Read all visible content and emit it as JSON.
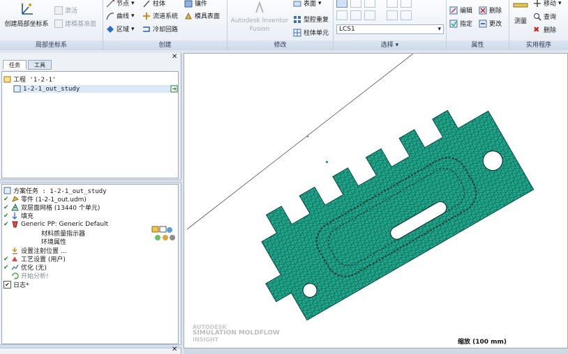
{
  "ribbon": {
    "local_cs": {
      "create_label": "创建局部坐标系",
      "activate_label": "激活",
      "modeling_base_label": "建模基准面",
      "group_label": "局部坐标系"
    },
    "create": {
      "node_label": "节点",
      "curve_label": "曲线",
      "region_label": "区域",
      "column_label": "柱体",
      "runner_label": "流道系统",
      "cooling_label": "冷却回路",
      "insert_label": "镶件",
      "mold_surface_label": "模具表面",
      "group_label": "创建"
    },
    "modify": {
      "fusion_label": "Autodesk Inventor Fusion",
      "surface_label": "表面",
      "cavity_label": "型腔重复",
      "column_unit_label": "柱体单元",
      "group_label": "修改"
    },
    "select": {
      "lcs_value": "LCS1",
      "group_label": "选择"
    },
    "properties": {
      "edit_label": "编辑",
      "assign_label": "指定",
      "delete_label": "删除",
      "change_label": "更改",
      "group_label": "属性"
    },
    "utilities": {
      "measure_label": "测量",
      "move_label": "移动",
      "query_label": "查询",
      "delete_label": "删除",
      "group_label": "实用程序"
    }
  },
  "left_panel": {
    "tabs": [
      "任务",
      "工具"
    ],
    "project_label": "工程 '1-2-1'",
    "study_label": "1-2-1_out_study",
    "task_title": "方案任务 : 1-2-1_out_study",
    "tasks": [
      "零件 (1-2-1_out.udm)",
      "双层面网格 (13440 个单元)",
      "填充",
      "Generic PP: Generic Default",
      "材料质量指示器",
      "环境属性",
      "设置注射位置 ...",
      "工艺设置 (用户)",
      "优化 (无)",
      "开始分析!",
      "日志*"
    ]
  },
  "viewport": {
    "scale_label": "缩放 (100 mm)",
    "watermark_line1": "AUTODESK",
    "watermark_line2": "SIMULATION MOLDFLOW",
    "watermark_line3": "INSIGHT"
  },
  "colors": {
    "mesh": "#1fa58a",
    "mesh_line": "#0e5c4c",
    "ribbon_label": "#cdd9e8"
  }
}
